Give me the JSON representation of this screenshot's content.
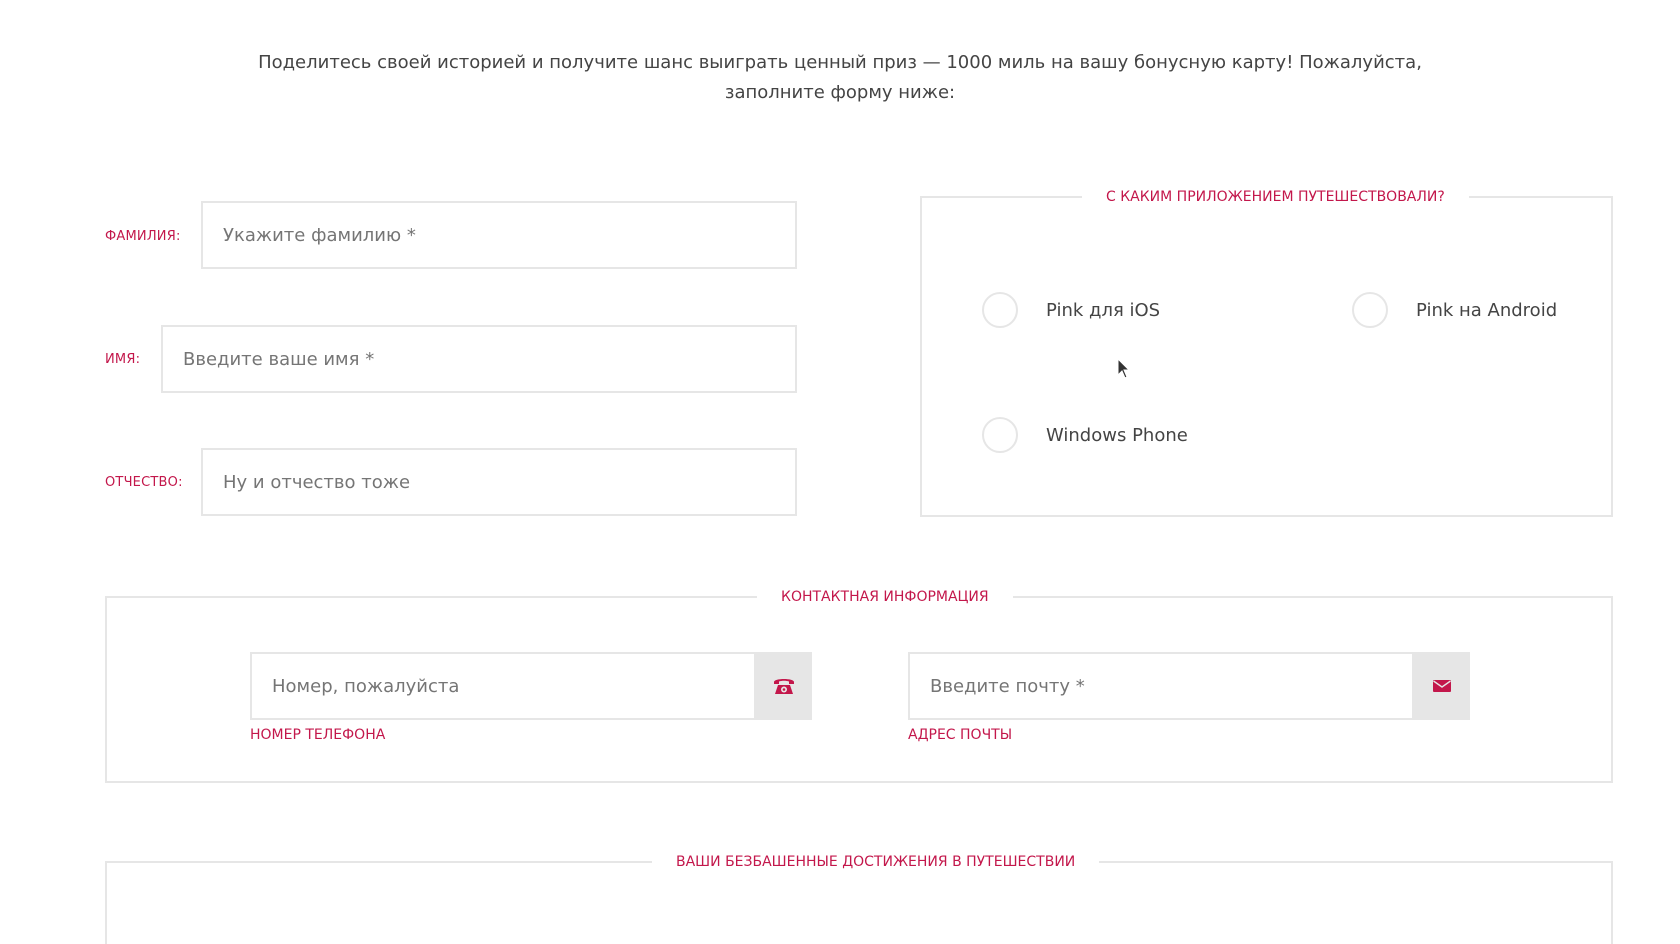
{
  "intro": {
    "text": "Поделитесь своей историей и получите шанс выиграть ценный приз — 1000 миль на вашу бонусную карту! Пожалуйста, заполните форму ниже:"
  },
  "personal": {
    "surname_label": "ФАМИЛИЯ:",
    "surname_placeholder": "Укажите фамилию *",
    "name_label": "ИМЯ:",
    "name_placeholder": "Введите ваше имя *",
    "patronymic_label": "ОТЧЕСТВО:",
    "patronymic_placeholder": "Ну и отчество тоже"
  },
  "app_choice": {
    "legend": "С КАКИМ ПРИЛОЖЕНИЕМ ПУТЕШЕСТВОВАЛИ?",
    "options": [
      {
        "label": "Pink для iOS"
      },
      {
        "label": "Pink на Android"
      },
      {
        "label": "Windows Phone"
      }
    ]
  },
  "contacts": {
    "legend": "КОНТАКТНАЯ ИНФОРМАЦИЯ",
    "phone_placeholder": "Номер, пожалуйста",
    "phone_label": "НОМЕР ТЕЛЕФОНА",
    "phone_icon": "phone-icon",
    "email_placeholder": "Введите почту *",
    "email_label": "АДРЕС ПОЧТЫ",
    "email_icon": "mail-icon"
  },
  "achievements": {
    "legend": "ВАШИ БЕЗБАШЕННЫЕ ДОСТИЖЕНИЯ В ПУТЕШЕСТВИИ"
  },
  "colors": {
    "accent": "#c3174b",
    "border": "#e6e6e6",
    "text": "#444444"
  }
}
